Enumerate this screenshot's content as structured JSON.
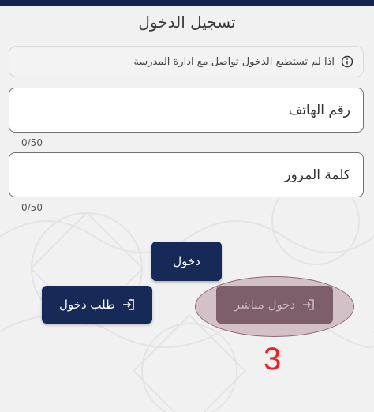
{
  "page": {
    "title": "تسجيل الدخول"
  },
  "notice": {
    "icon": "info-icon",
    "text": "اذا لم تستطيع الدخول تواصل مع ادارة المدرسة"
  },
  "form": {
    "phone": {
      "placeholder": "رقم الهاتف",
      "value": "",
      "counter": "0/50"
    },
    "password": {
      "placeholder": "كلمة المرور",
      "value": "",
      "counter": "0/50"
    }
  },
  "buttons": {
    "login_label": "دخول",
    "request_login_label": "طلب دخول",
    "request_login_icon": "login-icon",
    "direct_login_label": "دخول مباشر",
    "direct_login_icon": "login-icon"
  },
  "annotation": {
    "step_number": "3",
    "color": "#ef1f1f"
  },
  "colors": {
    "primary": "#172a57",
    "top_bar": "#13244f",
    "highlight": "#d4c0c7",
    "direct_button": "#7c5f6b"
  }
}
